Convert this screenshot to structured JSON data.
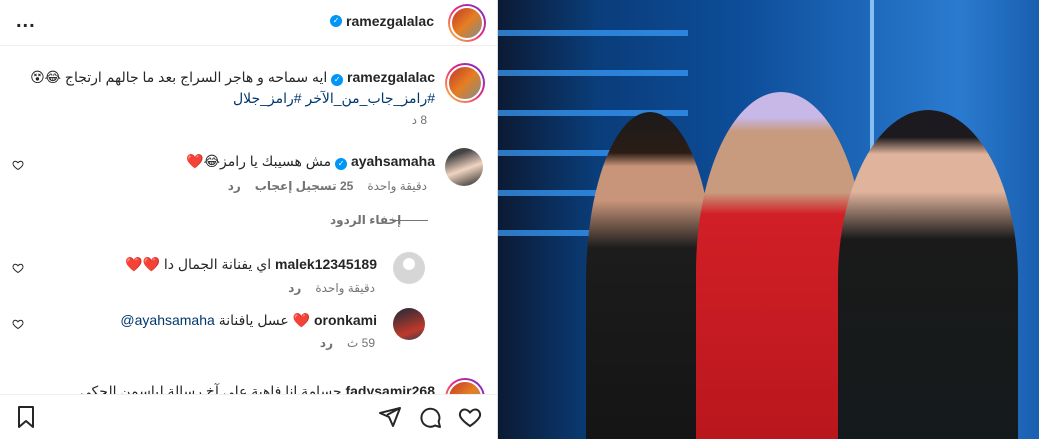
{
  "header": {
    "username": "ramezgalalac",
    "more_label": "..."
  },
  "caption": {
    "username": "ramezgalalac",
    "text": "ايه سماحه و هاجر السراج بعد ما جالهم ارتجاج 😂😵",
    "hashtags": "#رامز_جاب_من_الآخر #رامز_جلال",
    "time": "8 د"
  },
  "comments": [
    {
      "username": "ayahsamaha",
      "text": "مش هسيبك يا رامز😂❤️",
      "time": "دقيقة واحدة",
      "likes": "25 تسجيل إعجاب",
      "reply": "رد"
    }
  ],
  "hide_replies": "إخفاء الردود",
  "replies": [
    {
      "username": "malek12345189",
      "text": "اي يفنانة الجمال دا ❤️❤️",
      "time": "دقيقة واحدة",
      "reply": "رد"
    },
    {
      "username": "oronkami",
      "text": "❤️ عسل يافنانة",
      "mention": "@ayahsamaha",
      "time": "59 ث",
      "reply": "رد"
    }
  ],
  "partial_comment": {
    "username": "fadysamir268",
    "text": "جسامة انا فاهبة على آخ رسالة لياسمن الحكي"
  },
  "colors": {
    "accent": "#0095f6",
    "link": "#00376b",
    "muted": "#737373",
    "heart": "#ed4956"
  },
  "icons": [
    "more-icon",
    "verified-icon",
    "heart-icon",
    "bookmark-icon",
    "share-icon",
    "comment-icon"
  ]
}
